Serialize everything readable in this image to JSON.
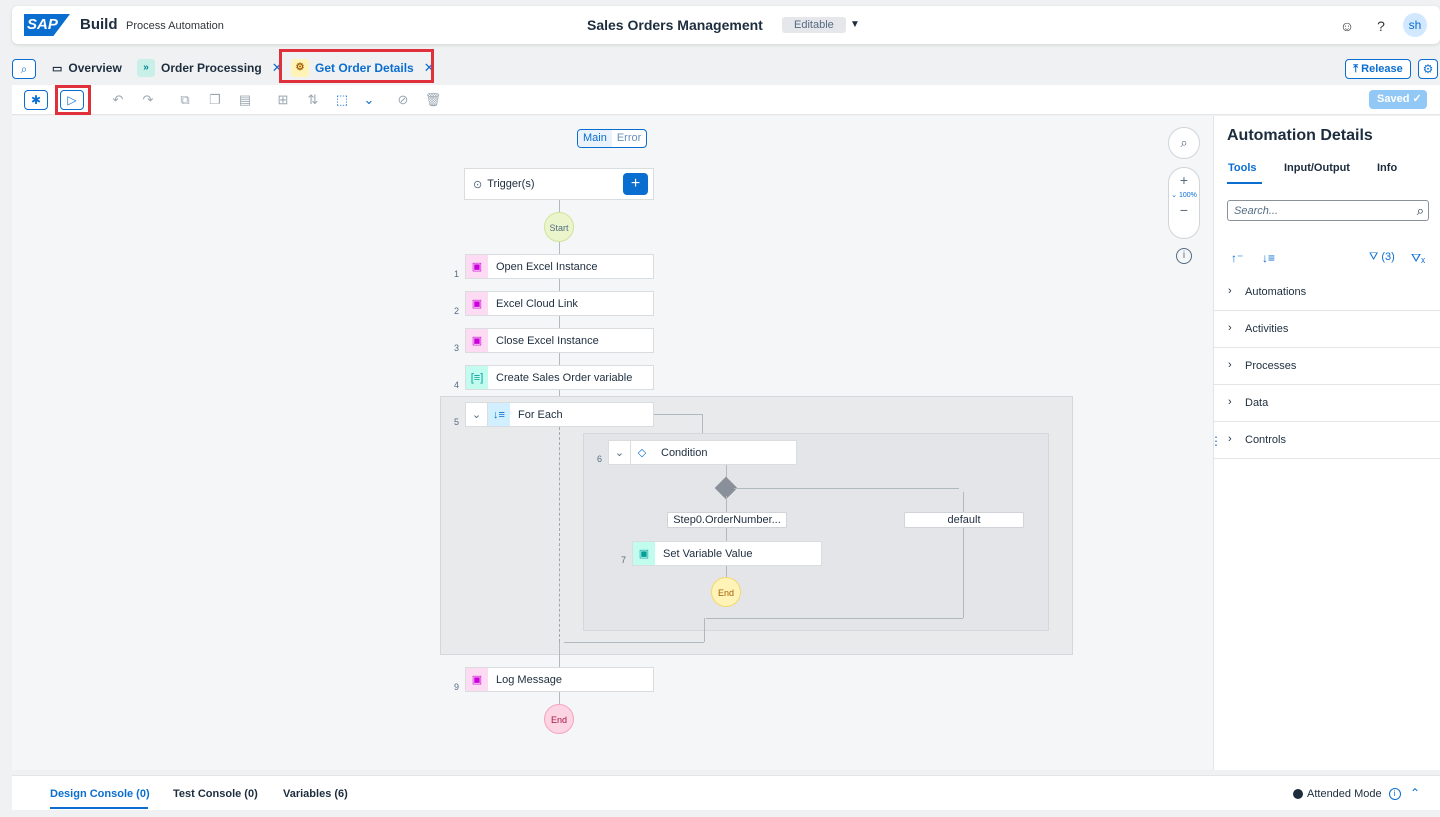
{
  "shell": {
    "logo": "SAP",
    "brand": "Build",
    "product": "Process Automation",
    "project": "Sales Orders Management",
    "status": "Editable",
    "avatar": "sh"
  },
  "tabs": [
    {
      "label": "Overview",
      "icon": "folder-icon"
    },
    {
      "label": "Order Processing",
      "icon": "process-icon"
    },
    {
      "label": "Get Order Details",
      "icon": "automation-icon"
    }
  ],
  "release_label": "Release",
  "saved_label": "Saved",
  "canvas": {
    "seg": {
      "main": "Main",
      "error": "Error"
    },
    "trigger": "Trigger(s)",
    "start": "Start",
    "end": "End",
    "steps": [
      {
        "num": "1",
        "label": "Open Excel Instance"
      },
      {
        "num": "2",
        "label": "Excel Cloud Link"
      },
      {
        "num": "3",
        "label": "Close Excel Instance"
      },
      {
        "num": "4",
        "label": "Create Sales Order variable"
      },
      {
        "num": "5",
        "label": "For Each"
      },
      {
        "num": "6",
        "label": "Condition"
      },
      {
        "num": "7",
        "label": "Set Variable Value"
      },
      {
        "num": "9",
        "label": "Log Message"
      }
    ],
    "branch_left": "Step0.OrderNumber...",
    "branch_right": "default",
    "zoom_level": "100%"
  },
  "side": {
    "title": "Automation Details",
    "tabs": [
      "Tools",
      "Input/Output",
      "Info"
    ],
    "search_placeholder": "Search...",
    "filter_count": "(3)",
    "categories": [
      "Automations",
      "Activities",
      "Processes",
      "Data",
      "Controls"
    ]
  },
  "bottom": {
    "tabs": [
      "Design Console (0)",
      "Test Console (0)",
      "Variables (6)"
    ],
    "mode": "Attended Mode"
  },
  "colors": {
    "accent": "#0a6ed1",
    "highlight": "#e0303c"
  }
}
